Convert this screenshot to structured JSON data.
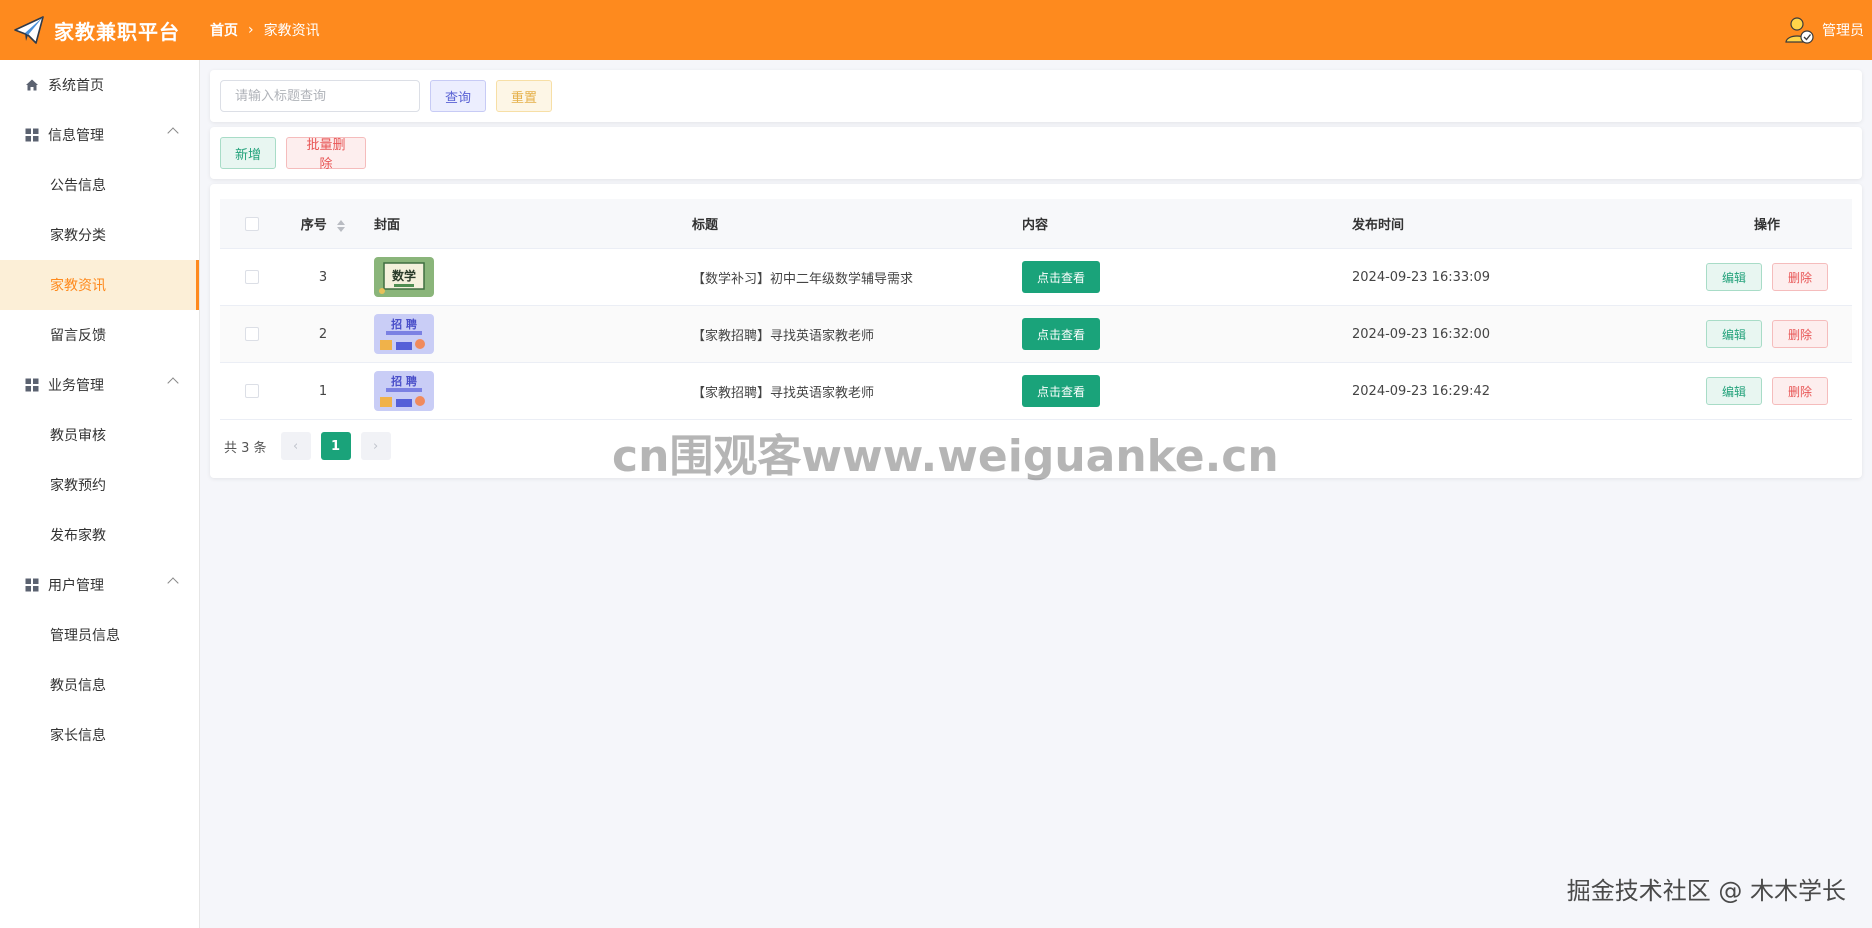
{
  "app": {
    "name": "家教兼职平台"
  },
  "breadcrumb": {
    "home": "首页",
    "current": "家教资讯"
  },
  "user": {
    "name": "管理员"
  },
  "sidebar": {
    "home": "系统首页",
    "groups": [
      {
        "label": "信息管理",
        "items": [
          "公告信息",
          "家教分类",
          "家教资讯",
          "留言反馈"
        ]
      },
      {
        "label": "业务管理",
        "items": [
          "教员审核",
          "家教预约",
          "发布家教"
        ]
      },
      {
        "label": "用户管理",
        "items": [
          "管理员信息",
          "教员信息",
          "家长信息"
        ]
      }
    ],
    "active": "家教资讯"
  },
  "search": {
    "placeholder": "请输入标题查询",
    "query_label": "查询",
    "reset_label": "重置"
  },
  "actions": {
    "add_label": "新增",
    "batch_delete_label": "批量删除"
  },
  "table": {
    "headers": {
      "seq": "序号",
      "cover": "封面",
      "title": "标题",
      "content": "内容",
      "time": "发布时间",
      "op": "操作"
    },
    "rows": [
      {
        "seq": "3",
        "cover": "math-cover",
        "cover_text": "数学",
        "title": "【数学补习】初中二年级数学辅导需求",
        "view_label": "点击查看",
        "time": "2024-09-23 16:33:09",
        "edit_label": "编辑",
        "delete_label": "删除"
      },
      {
        "seq": "2",
        "cover": "recruit-cover",
        "cover_text": "招 聘",
        "title": "【家教招聘】寻找英语家教老师",
        "view_label": "点击查看",
        "time": "2024-09-23 16:32:00",
        "edit_label": "编辑",
        "delete_label": "删除"
      },
      {
        "seq": "1",
        "cover": "recruit-cover",
        "cover_text": "招 聘",
        "title": "【家教招聘】寻找英语家教老师",
        "view_label": "点击查看",
        "time": "2024-09-23 16:29:42",
        "edit_label": "编辑",
        "delete_label": "删除"
      }
    ]
  },
  "pagination": {
    "total_text": "共 3 条",
    "current": "1"
  },
  "watermarks": {
    "center": "cn围观客www.weiguanke.cn",
    "corner": "掘金技术社区 @ 木木学长"
  },
  "colors": {
    "header": "#fe8a1e",
    "primary_green": "#1aa37a",
    "active_bg": "#fcefd7"
  }
}
